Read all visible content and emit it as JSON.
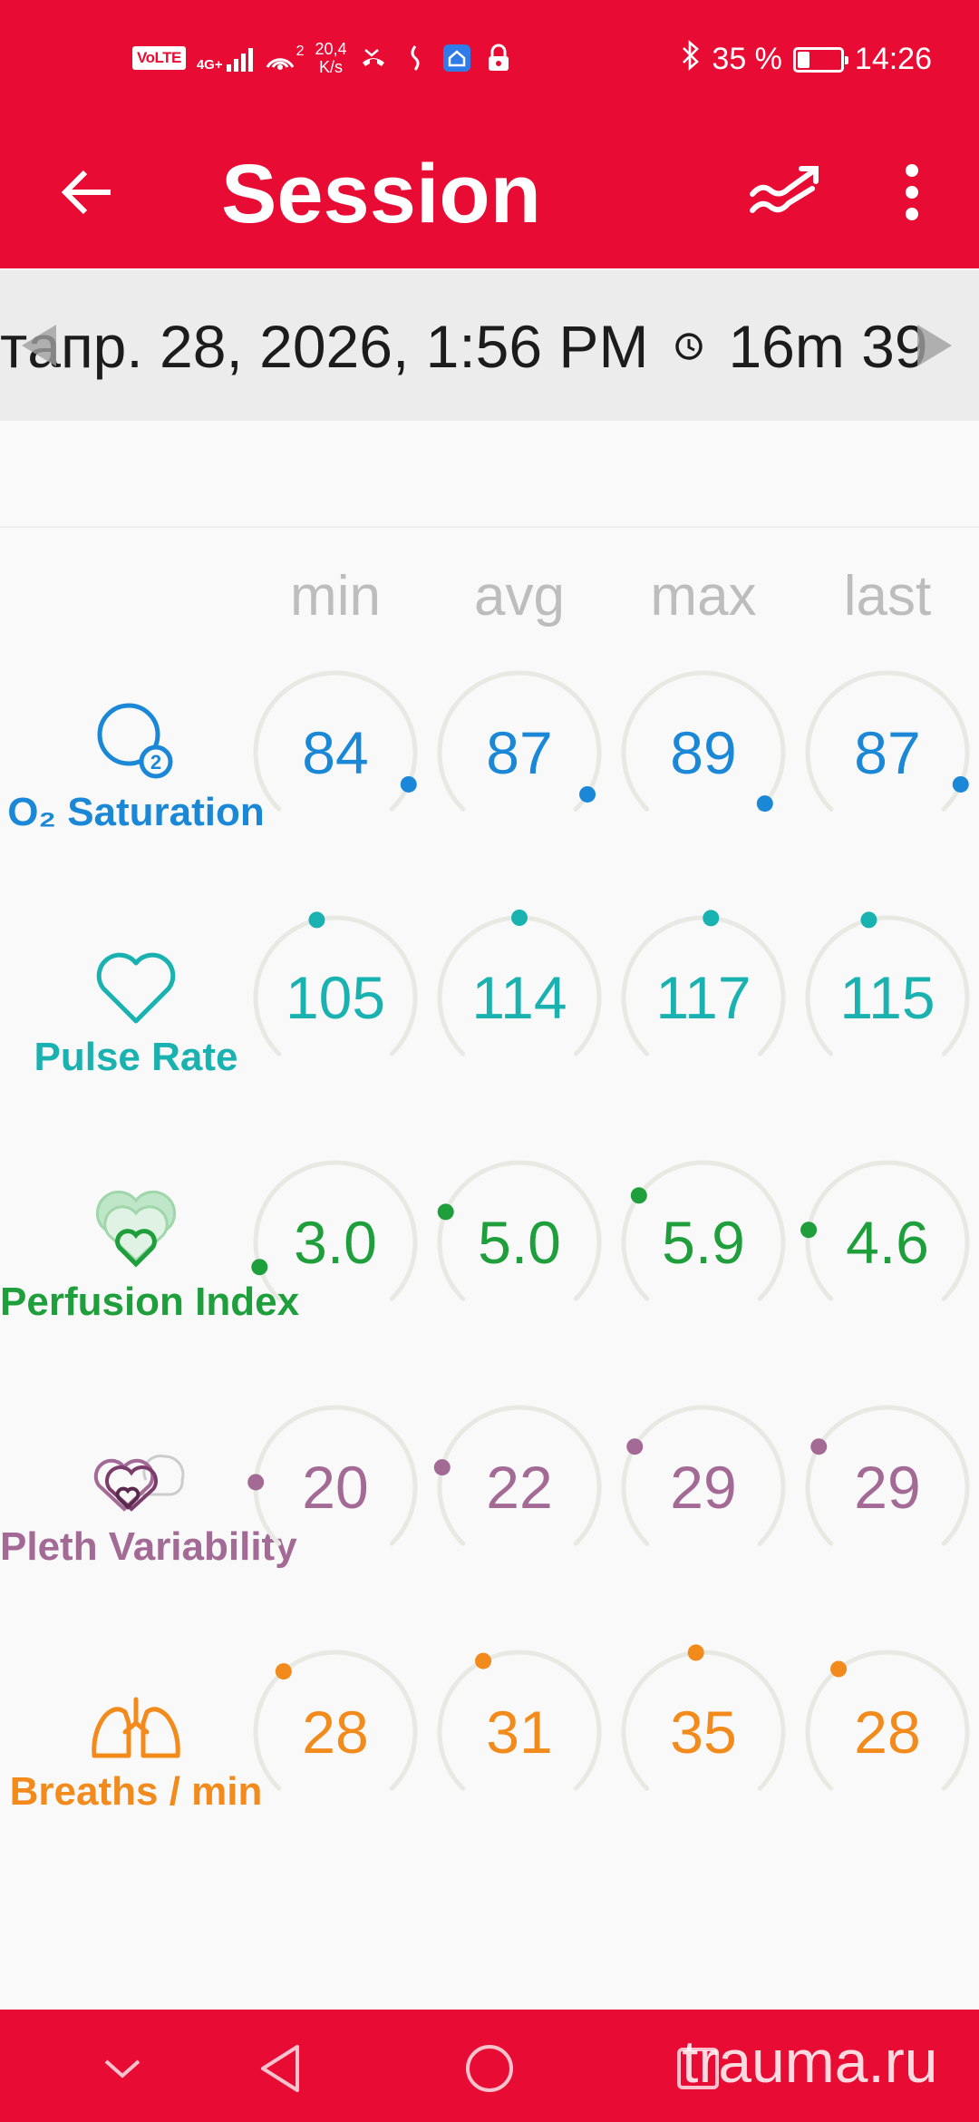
{
  "status_bar": {
    "volte": "VoLTE",
    "network": "4G+",
    "hotspot_count": "2",
    "speed_value": "20,4",
    "speed_unit": "K/s",
    "battery_percent": "35 %",
    "time": "14:26"
  },
  "app_bar": {
    "title": "Session"
  },
  "session": {
    "date_prefix": "т",
    "date": "апр. 28, 2026, 1:56 PM",
    "duration": "16m 39"
  },
  "columns": [
    "min",
    "avg",
    "max",
    "last"
  ],
  "metrics": [
    {
      "name": "O₂ Saturation",
      "label_id": "o2-saturation",
      "color": "#1a88d6",
      "icon": "o2-saturation-icon",
      "values": [
        "84",
        "87",
        "89",
        "87"
      ],
      "levels": [
        0.92,
        0.95,
        0.98,
        0.92
      ]
    },
    {
      "name": "Pulse Rate",
      "label_id": "pulse-rate",
      "color": "#1ab2b0",
      "icon": "heart-icon",
      "values": [
        "105",
        "114",
        "117",
        "115"
      ],
      "levels": [
        0.45,
        0.5,
        0.52,
        0.45
      ]
    },
    {
      "name": "Perfusion Index",
      "label_id": "perfusion-index",
      "color": "#1f9e3c",
      "icon": "perfusion-icon",
      "values": [
        "3.0",
        "5.0",
        "5.9",
        "4.6"
      ],
      "levels": [
        0.1,
        0.25,
        0.3,
        0.2
      ]
    },
    {
      "name": "Pleth Variability",
      "label_id": "pleth-variability",
      "color": "#a36a96",
      "icon": "pleth-variability-icon",
      "values": [
        "20",
        "22",
        "29",
        "29"
      ],
      "levels": [
        0.18,
        0.22,
        0.28,
        0.28
      ]
    },
    {
      "name": "Breaths / min",
      "label_id": "breaths-per-min",
      "color": "#f28a1c",
      "icon": "lungs-icon",
      "values": [
        "28",
        "31",
        "35",
        "28"
      ],
      "levels": [
        0.35,
        0.4,
        0.48,
        0.36
      ]
    }
  ],
  "watermark": "trauma.ru"
}
